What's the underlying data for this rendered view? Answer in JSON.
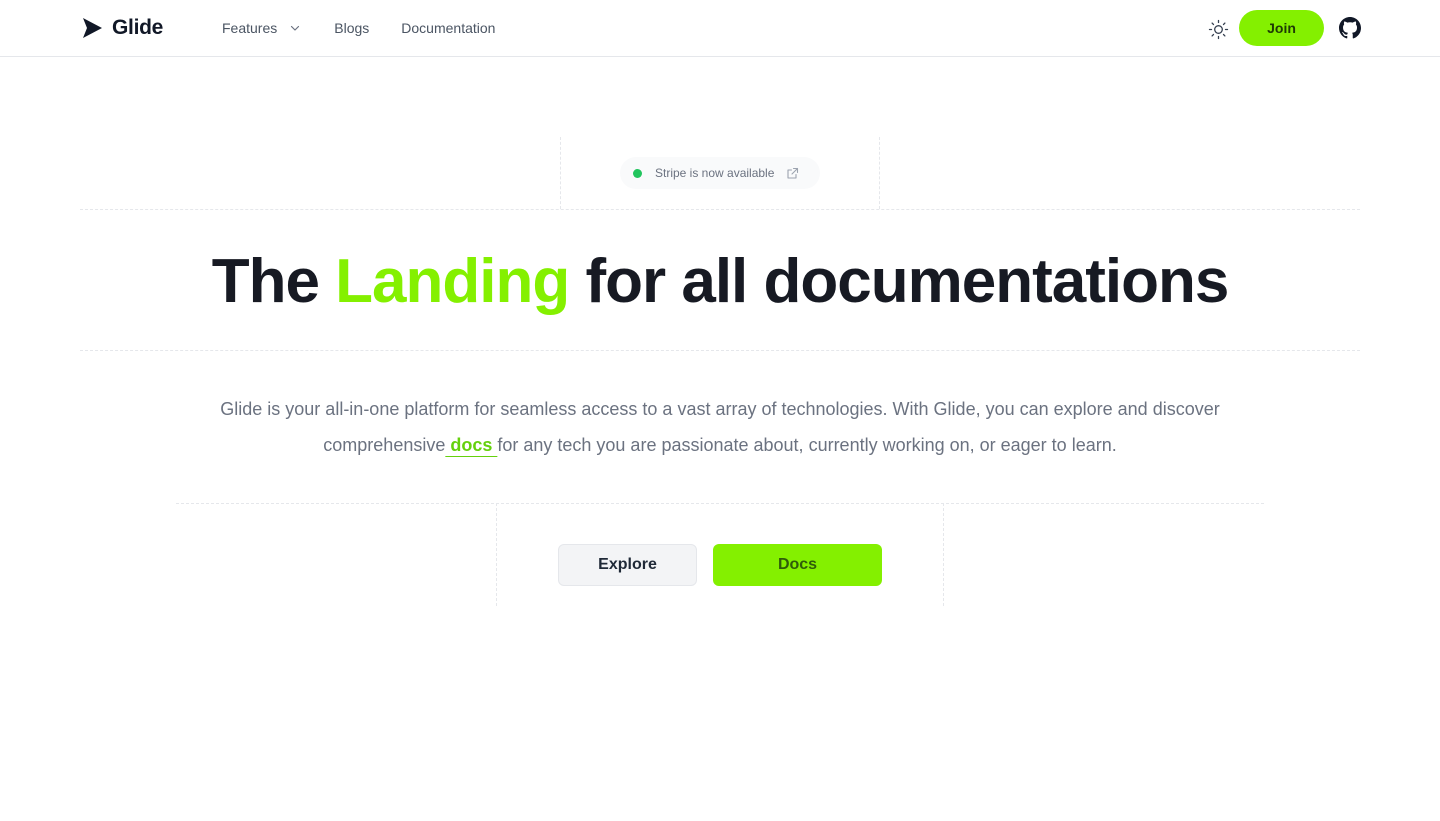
{
  "header": {
    "brand": "Glide",
    "nav": {
      "features": "Features",
      "blogs": "Blogs",
      "documentation": "Documentation"
    },
    "join_label": "Join",
    "icons": {
      "logo": "play-triangle-icon",
      "features_chevron": "chevron-down-icon",
      "theme": "sun-icon",
      "github": "github-icon"
    }
  },
  "hero": {
    "badge": {
      "text": "Stripe is now available",
      "dot_color": "#22c55e",
      "icon": "external-link-icon"
    },
    "headline": {
      "prefix": "The ",
      "accent": "Landing",
      "suffix": " for all documentations"
    },
    "description": {
      "before_link": "Glide is your all-in-one platform for seamless access to a vast array of technologies. With Glide, you can explore and discover comprehensive",
      "link": " docs ",
      "after_link": "for any tech you are passionate about, currently working on, or eager to learn."
    },
    "buttons": {
      "explore": "Explore",
      "docs": "Docs"
    }
  },
  "colors": {
    "accent": "#84f000",
    "text": "#171a23",
    "muted": "#6b7280"
  }
}
